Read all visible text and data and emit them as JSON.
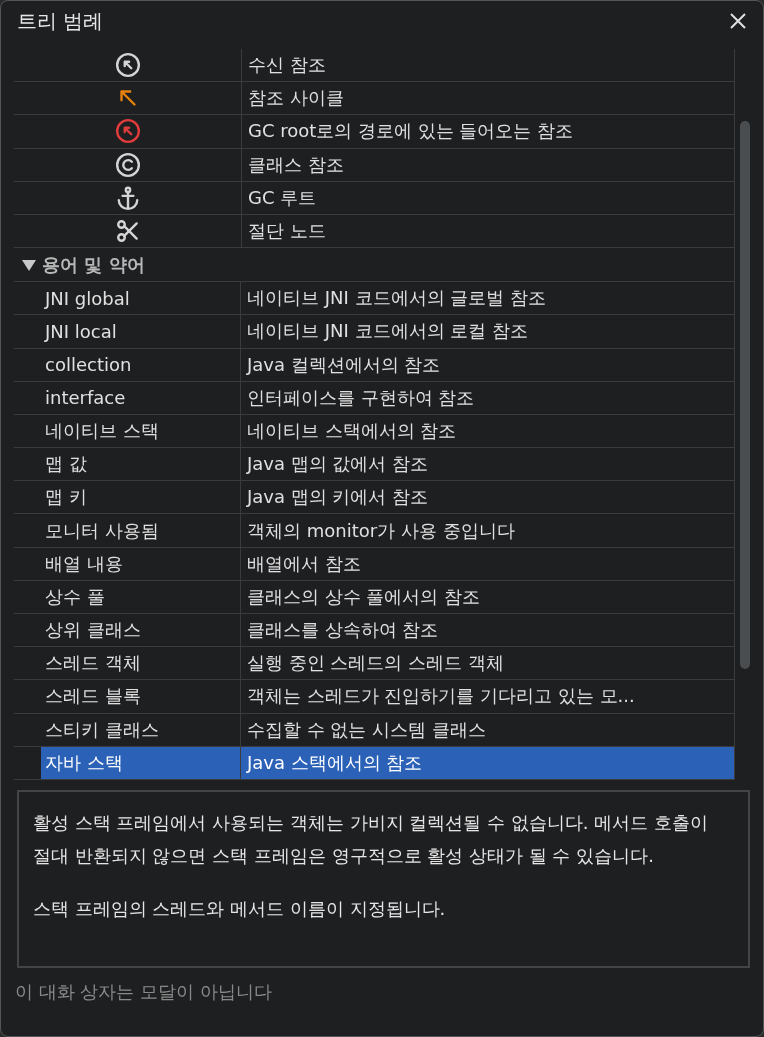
{
  "window": {
    "title": "트리 범례"
  },
  "icon_rows": [
    {
      "kind": "circle-arrow",
      "color": "#d4d4d4",
      "description": "수신 참조"
    },
    {
      "kind": "arrow",
      "color": "#e8820c",
      "description": "참조 사이클"
    },
    {
      "kind": "circle-arrow",
      "color": "#e03c3c",
      "description": "GC root로의 경로에 있는 들어오는 참조"
    },
    {
      "kind": "copyright",
      "color": "#d4d4d4",
      "description": "클래스 참조"
    },
    {
      "kind": "anchor",
      "color": "#d4d4d4",
      "description": "GC 루트"
    },
    {
      "kind": "scissors",
      "color": "#d4d4d4",
      "description": "절단 노드"
    }
  ],
  "group": {
    "label": "용어 및 약어",
    "expanded": true,
    "rows": [
      {
        "term": "JNI global",
        "description": "네이티브 JNI 코드에서의 글로벌 참조",
        "selected": false
      },
      {
        "term": "JNI local",
        "description": "네이티브 JNI 코드에서의 로컬 참조",
        "selected": false
      },
      {
        "term": "collection",
        "description": "Java 컬렉션에서의 참조",
        "selected": false
      },
      {
        "term": "interface",
        "description": "인터페이스를 구현하여 참조",
        "selected": false
      },
      {
        "term": "네이티브 스택",
        "description": "네이티브 스택에서의 참조",
        "selected": false
      },
      {
        "term": "맵 값",
        "description": "Java 맵의 값에서 참조",
        "selected": false
      },
      {
        "term": "맵 키",
        "description": "Java 맵의 키에서 참조",
        "selected": false
      },
      {
        "term": "모니터 사용됨",
        "description": "객체의 monitor가 사용 중입니다",
        "selected": false
      },
      {
        "term": "배열 내용",
        "description": "배열에서 참조",
        "selected": false
      },
      {
        "term": "상수 풀",
        "description": "클래스의 상수 풀에서의 참조",
        "selected": false
      },
      {
        "term": "상위 클래스",
        "description": "클래스를 상속하여 참조",
        "selected": false
      },
      {
        "term": "스레드 객체",
        "description": "실행 중인 스레드의 스레드 객체",
        "selected": false
      },
      {
        "term": "스레드 블록",
        "description": "객체는 스레드가 진입하기를 기다리고 있는 모...",
        "selected": false
      },
      {
        "term": "스티키 클래스",
        "description": "수집할 수 없는 시스템 클래스",
        "selected": false
      },
      {
        "term": "자바 스택",
        "description": "Java 스택에서의 참조",
        "selected": true
      }
    ]
  },
  "details": [
    "활성 스택 프레임에서 사용되는 객체는 가비지 컬렉션될 수 없습니다. 메서드 호출이 절대 반환되지 않으면 스택 프레임은 영구적으로 활성 상태가 될 수 있습니다.",
    "스택 프레임의 스레드와 메서드 이름이 지정됩니다."
  ],
  "footer": "이 대화 상자는 모달이 아닙니다"
}
